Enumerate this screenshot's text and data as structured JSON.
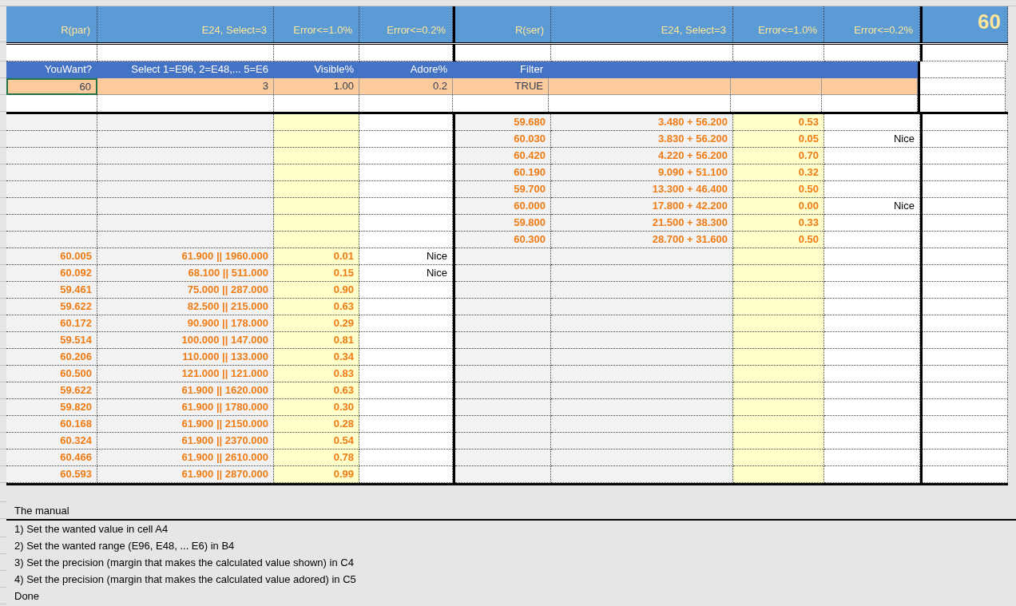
{
  "header_row": [
    "R(par)",
    "E24, Select=3",
    "Error<=1.0%",
    "Error<=0.2%",
    "R(ser)",
    "E24, Select=3",
    "Error<=1.0%",
    "Error<=0.2%",
    "60"
  ],
  "input_labels": [
    "YouWant?",
    "Select 1=E96, 2=E48,... 5=E6",
    "Visible%",
    "Adore%",
    "Filter"
  ],
  "inputs": [
    {
      "value": "60",
      "selected": true
    },
    {
      "value": "3",
      "selected": false
    },
    {
      "value": "1.00",
      "selected": false
    },
    {
      "value": "0.2",
      "selected": false
    },
    {
      "value": "TRUE",
      "selected": false
    }
  ],
  "rows": [
    {
      "series": {
        "r": "59.680",
        "pair": "3.480 + 56.200",
        "error": "0.53"
      }
    },
    {
      "series": {
        "r": "60.030",
        "pair": "3.830 + 56.200",
        "error": "0.05",
        "note": "Nice"
      }
    },
    {
      "series": {
        "r": "60.420",
        "pair": "4.220 + 56.200",
        "error": "0.70"
      }
    },
    {
      "series": {
        "r": "60.190",
        "pair": "9.090 + 51.100",
        "error": "0.32"
      }
    },
    {
      "series": {
        "r": "59.700",
        "pair": "13.300 + 46.400",
        "error": "0.50"
      }
    },
    {
      "series": {
        "r": "60.000",
        "pair": "17.800 + 42.200",
        "error": "0.00",
        "note": "Nice"
      }
    },
    {
      "series": {
        "r": "59.800",
        "pair": "21.500 + 38.300",
        "error": "0.33"
      }
    },
    {
      "series": {
        "r": "60.300",
        "pair": "28.700 + 31.600",
        "error": "0.50"
      }
    },
    {
      "parallel": {
        "r": "60.005",
        "pair": "61.900 || 1960.000",
        "error": "0.01",
        "note": "Nice"
      }
    },
    {
      "parallel": {
        "r": "60.092",
        "pair": "68.100 || 511.000",
        "error": "0.15",
        "note": "Nice"
      }
    },
    {
      "parallel": {
        "r": "59.461",
        "pair": "75.000 || 287.000",
        "error": "0.90"
      }
    },
    {
      "parallel": {
        "r": "59.622",
        "pair": "82.500 || 215.000",
        "error": "0.63"
      }
    },
    {
      "parallel": {
        "r": "60.172",
        "pair": "90.900 || 178.000",
        "error": "0.29"
      }
    },
    {
      "parallel": {
        "r": "59.514",
        "pair": "100.000 || 147.000",
        "error": "0.81"
      }
    },
    {
      "parallel": {
        "r": "60.206",
        "pair": "110.000 || 133.000",
        "error": "0.34"
      }
    },
    {
      "parallel": {
        "r": "60.500",
        "pair": "121.000 || 121.000",
        "error": "0.83"
      }
    },
    {
      "parallel": {
        "r": "59.622",
        "pair": "61.900 || 1620.000",
        "error": "0.63"
      }
    },
    {
      "parallel": {
        "r": "59.820",
        "pair": "61.900 || 1780.000",
        "error": "0.30"
      }
    },
    {
      "parallel": {
        "r": "60.168",
        "pair": "61.900 || 2150.000",
        "error": "0.28"
      }
    },
    {
      "parallel": {
        "r": "60.324",
        "pair": "61.900 || 2370.000",
        "error": "0.54"
      }
    },
    {
      "parallel": {
        "r": "60.466",
        "pair": "61.900 || 2610.000",
        "error": "0.78"
      }
    },
    {
      "parallel": {
        "r": "60.593",
        "pair": "61.900 || 2870.000",
        "error": "0.99"
      }
    }
  ],
  "manual": {
    "title": "The manual",
    "steps": [
      "1) Set the wanted value in cell A4",
      "2) Set the wanted range (E96, E48, ... E6) in B4",
      "3) Set the precision (margin that makes the calculated value shown) in C4",
      "4) Set the precision (margin that makes the calculated value adored) in C5",
      "Done"
    ]
  }
}
